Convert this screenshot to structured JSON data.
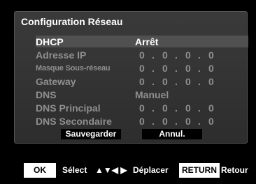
{
  "dialog": {
    "title": "Configuration Réseau"
  },
  "settings": [
    {
      "label": "DHCP",
      "value": "Arrêt"
    },
    {
      "label": "Adresse IP",
      "ip": [
        "0",
        ".",
        "0",
        ".",
        "0",
        ".",
        "0"
      ]
    },
    {
      "label": "Masque Sous-réseau",
      "ip": [
        "0",
        ".",
        "0",
        ".",
        "0",
        ".",
        "0"
      ]
    },
    {
      "label": "Gateway",
      "ip": [
        "0",
        ".",
        "0",
        ".",
        "0",
        ".",
        "0"
      ]
    },
    {
      "label": "DNS",
      "value": "Manuel"
    },
    {
      "label": "DNS Principal",
      "ip": [
        "0",
        ".",
        "0",
        ".",
        "0",
        ".",
        "0"
      ]
    },
    {
      "label": "DNS Secondaire",
      "ip": [
        "0",
        ".",
        "0",
        ".",
        "0",
        ".",
        "0"
      ]
    }
  ],
  "buttons": {
    "save": "Sauvegarder",
    "cancel": "Annul."
  },
  "footer": {
    "ok_key": "OK",
    "ok_text": "Sélect",
    "arrows": "▲▼◀ ▶",
    "move_text": "Déplacer",
    "return_key": "RETURN",
    "return_text": "Retour"
  },
  "colors": {
    "background": "#000000",
    "panel": "#363636",
    "selected_row": "#505050",
    "active_text": "#ffffff",
    "inactive_text": "#8f8f8f"
  }
}
